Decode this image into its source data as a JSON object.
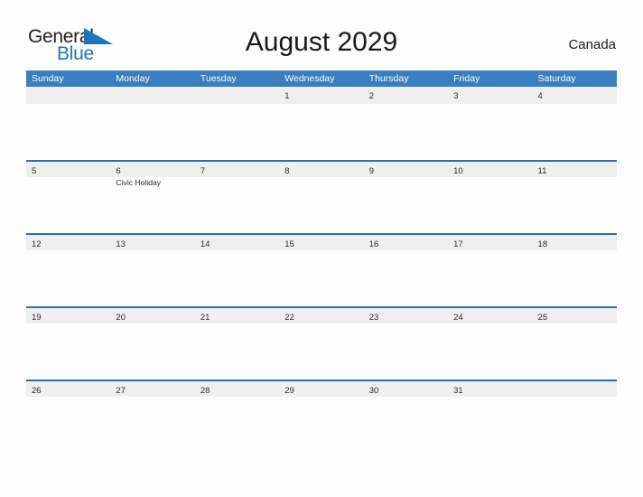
{
  "logo": {
    "word_one": "General",
    "word_two": "Blue",
    "flag_icon": "blue-triangle-flag-icon",
    "color_dark": "#231f20",
    "color_blue": "#1b75bb"
  },
  "header": {
    "title": "August 2029",
    "country": "Canada"
  },
  "theme": {
    "header_blue": "#3a7ebe",
    "divider_blue": "#2c6eae",
    "date_band_gray": "#efefef",
    "page_background": "#fdfdfd",
    "text_dark": "#2b2b2b"
  },
  "calendar": {
    "weekdays": [
      "Sunday",
      "Monday",
      "Tuesday",
      "Wednesday",
      "Thursday",
      "Friday",
      "Saturday"
    ],
    "weeks": [
      [
        {
          "date": "",
          "event": ""
        },
        {
          "date": "",
          "event": ""
        },
        {
          "date": "",
          "event": ""
        },
        {
          "date": "1",
          "event": ""
        },
        {
          "date": "2",
          "event": ""
        },
        {
          "date": "3",
          "event": ""
        },
        {
          "date": "4",
          "event": ""
        }
      ],
      [
        {
          "date": "5",
          "event": ""
        },
        {
          "date": "6",
          "event": "Civic Holiday"
        },
        {
          "date": "7",
          "event": ""
        },
        {
          "date": "8",
          "event": ""
        },
        {
          "date": "9",
          "event": ""
        },
        {
          "date": "10",
          "event": ""
        },
        {
          "date": "11",
          "event": ""
        }
      ],
      [
        {
          "date": "12",
          "event": ""
        },
        {
          "date": "13",
          "event": ""
        },
        {
          "date": "14",
          "event": ""
        },
        {
          "date": "15",
          "event": ""
        },
        {
          "date": "16",
          "event": ""
        },
        {
          "date": "17",
          "event": ""
        },
        {
          "date": "18",
          "event": ""
        }
      ],
      [
        {
          "date": "19",
          "event": ""
        },
        {
          "date": "20",
          "event": ""
        },
        {
          "date": "21",
          "event": ""
        },
        {
          "date": "22",
          "event": ""
        },
        {
          "date": "23",
          "event": ""
        },
        {
          "date": "24",
          "event": ""
        },
        {
          "date": "25",
          "event": ""
        }
      ],
      [
        {
          "date": "26",
          "event": ""
        },
        {
          "date": "27",
          "event": ""
        },
        {
          "date": "28",
          "event": ""
        },
        {
          "date": "29",
          "event": ""
        },
        {
          "date": "30",
          "event": ""
        },
        {
          "date": "31",
          "event": ""
        },
        {
          "date": "",
          "event": ""
        }
      ]
    ]
  }
}
